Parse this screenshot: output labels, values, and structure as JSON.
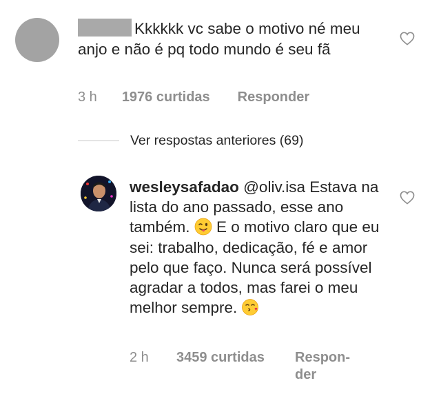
{
  "comment1": {
    "text": "Kkkkkk vc sabe o motivo né meu anjo e não é pq todo mundo é seu fã",
    "time": "3 h",
    "likes": "1976 curtidas",
    "reply_label": "Responder",
    "like_icon": "heart-outline-icon"
  },
  "previous_replies": {
    "label": "Ver respostas anteriores (69)"
  },
  "reply": {
    "username": "wesleysafadao",
    "text_part1": " @oliv.isa Estava na lista do ano passado, esse ano também. ",
    "emoji1": "winking-face-with-tongue",
    "text_part2": " E o motivo claro que eu sei: trabalho, dedicação, fé e amor pelo que faço. Nunca será possível agradar a todos, mas farei o meu melhor sempre.",
    "emoji2": "face-blowing-a-kiss",
    "time": "2 h",
    "likes": "3459 curtidas",
    "reply_label": "Respon-der",
    "like_icon": "heart-outline-icon"
  },
  "colors": {
    "text": "#262626",
    "meta": "#8e8e8e",
    "avatar_placeholder": "#a3a3a3",
    "divider": "#c7c7c7"
  }
}
